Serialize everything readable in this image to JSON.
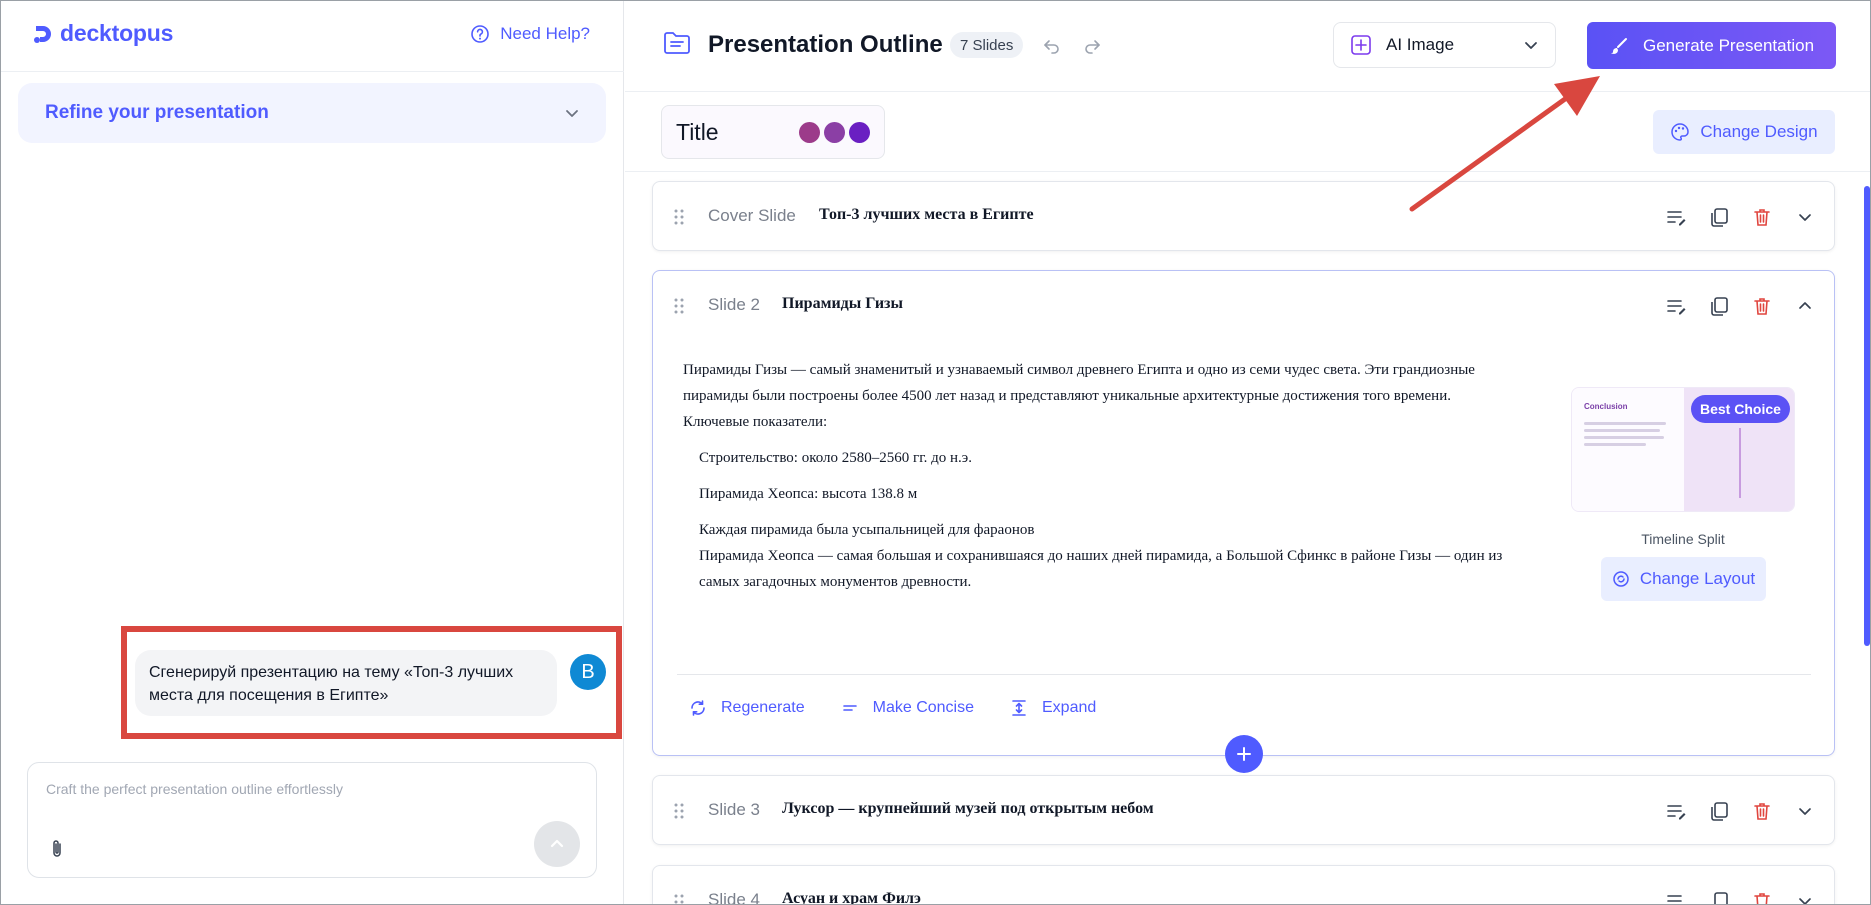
{
  "left": {
    "logo_text": "decktopus",
    "help_label": "Need Help?",
    "refine_label": "Refine your presentation",
    "chat": {
      "message": "Сгенерируй презентацию на тему «Топ-3 лучших места для посещения в Египте»",
      "avatar_initial": "B"
    },
    "composer": {
      "placeholder": "Craft the perfect presentation outline effortlessly"
    }
  },
  "toolbar": {
    "title": "Presentation Outline",
    "slide_count": "7 Slides",
    "image_mode": "AI Image",
    "generate_label": "Generate Presentation"
  },
  "design": {
    "theme_title": "Title",
    "theme_colors": [
      "#9c3b8a",
      "#8b3fa5",
      "#6a1fc2"
    ],
    "change_design_label": "Change Design"
  },
  "slides": [
    {
      "label": "Cover Slide",
      "title": "Топ-3 лучших места в Египте"
    },
    {
      "label": "Slide 2",
      "title": "Пирамиды Гизы",
      "body": {
        "intro": "Пирамиды Гизы — самый знаменитый и узнаваемый символ древнего Египта и одно из семи чудес света. Эти грандиозные пирамиды были построены более 4500 лет назад и представляют уникальные архитектурные достижения того времени. Ключевые показатели:",
        "point1": "Строительство: около 2580–2560 гг. до н.э.",
        "point2": "Пирамида Хеопса: высота 138.8 м",
        "point3": "Каждая пирамида была усыпальницей для фараонов",
        "point4": "Пирамида Хеопса — самая большая и сохранившаяся до наших дней пирамида, а Большой Сфинкс в районе Гизы — один из самых загадочных монументов древности."
      },
      "layout": {
        "thumb_title": "Conclusion",
        "badge": "Best Choice",
        "name": "Timeline Split",
        "change_label": "Change Layout"
      },
      "actions": {
        "regenerate": "Regenerate",
        "concise": "Make Concise",
        "expand": "Expand"
      }
    },
    {
      "label": "Slide 3",
      "title": "Луксор — крупнейший музей под открытым небом"
    },
    {
      "label": "Slide 4",
      "title": "Асуан и храм Филэ"
    }
  ],
  "colors": {
    "accent": "#4f5bff",
    "annotation": "#d9473f",
    "delete": "#e0453e"
  }
}
